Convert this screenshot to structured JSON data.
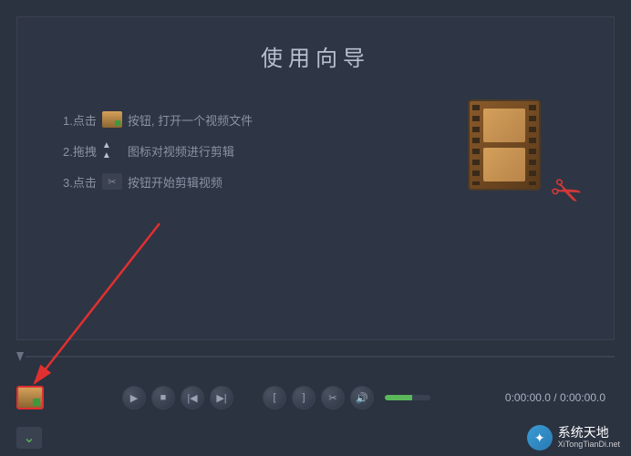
{
  "wizard": {
    "title": "使用向导",
    "steps": [
      {
        "prefix": "1.点击",
        "icon": "folder-open-icon",
        "suffix": "按钮, 打开一个视频文件"
      },
      {
        "prefix": "2.拖拽",
        "icon": "arrows-icon",
        "suffix": "图标对视频进行剪辑"
      },
      {
        "prefix": "3.点击",
        "icon": "scissors-icon",
        "suffix": "按钮开始剪辑视频"
      }
    ]
  },
  "controls": {
    "time_current": "0:00:00.0",
    "time_total": "0:00:00.0",
    "volume_pct": 60
  },
  "watermark": {
    "brand": "系统天地",
    "url": "XiTongTianDi.net"
  }
}
